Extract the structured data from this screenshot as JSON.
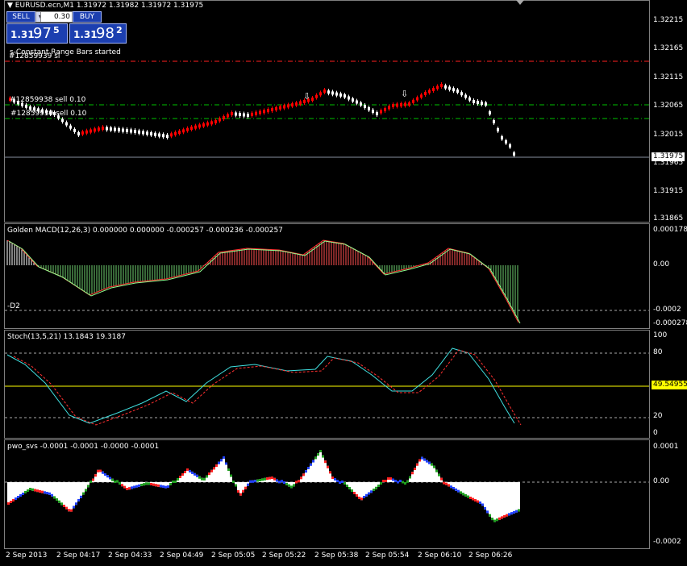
{
  "chart_window": {
    "symbol_ohlc": "EURUSD.ecn,M1  1.31972 1.31982 1.31972 1.31975",
    "current_price": "1.31975",
    "custom_bars_label": "s-Constant Range Bars started",
    "order_label_top": "#12859939 sl",
    "order_label_1": "#12859938 sell 0.10",
    "order_label_2": "#12859939 sell 0.10"
  },
  "trade_panel": {
    "sell_label": "SELL",
    "buy_label": "BUY",
    "lot_value": "0.30",
    "sell_price_big": "1.31",
    "sell_price_pips": "97",
    "sell_price_frac": "5",
    "buy_price_big": "1.31",
    "buy_price_pips": "98",
    "buy_price_frac": "2"
  },
  "price_axis": [
    "1.32215",
    "1.32165",
    "1.32115",
    "1.32065",
    "1.32015",
    "1.31965",
    "1.31915",
    "1.31865"
  ],
  "macd": {
    "title": "Golden MACD(12,26,3) 0.000000 0.000000 -0.000257 -0.000236 -0.000257",
    "level_label": "-D2",
    "axis": [
      "0.000178",
      "0.00",
      "-0.0002",
      "-0.000278"
    ]
  },
  "stoch": {
    "title": "Stoch(13,5,21) 13.1843 19.3187",
    "axis": [
      "100",
      "80",
      "20",
      "0"
    ],
    "current_value": "49.54955"
  },
  "pwo": {
    "title": "pwo_svs -0.0001 -0.0001 -0.0000 -0.0001",
    "axis": [
      "0.0001",
      "0.00",
      "-0.0002"
    ]
  },
  "time_axis": [
    "2 Sep 2013",
    "2 Sep 04:17",
    "2 Sep 04:33",
    "2 Sep 04:49",
    "2 Sep 05:05",
    "2 Sep 05:22",
    "2 Sep 05:38",
    "2 Sep 05:54",
    "2 Sep 06:10",
    "2 Sep 06:26"
  ],
  "colors": {
    "bull": "#ff0000",
    "bear": "#ffffff",
    "order_line": "#00c000",
    "sl_line": "#ff2020",
    "macd_main": "#ff3030",
    "macd_signal": "#90ff90",
    "stoch_main": "#40e0e0",
    "stoch_signal": "#ff3030",
    "level_yellow": "#ffff00"
  }
}
